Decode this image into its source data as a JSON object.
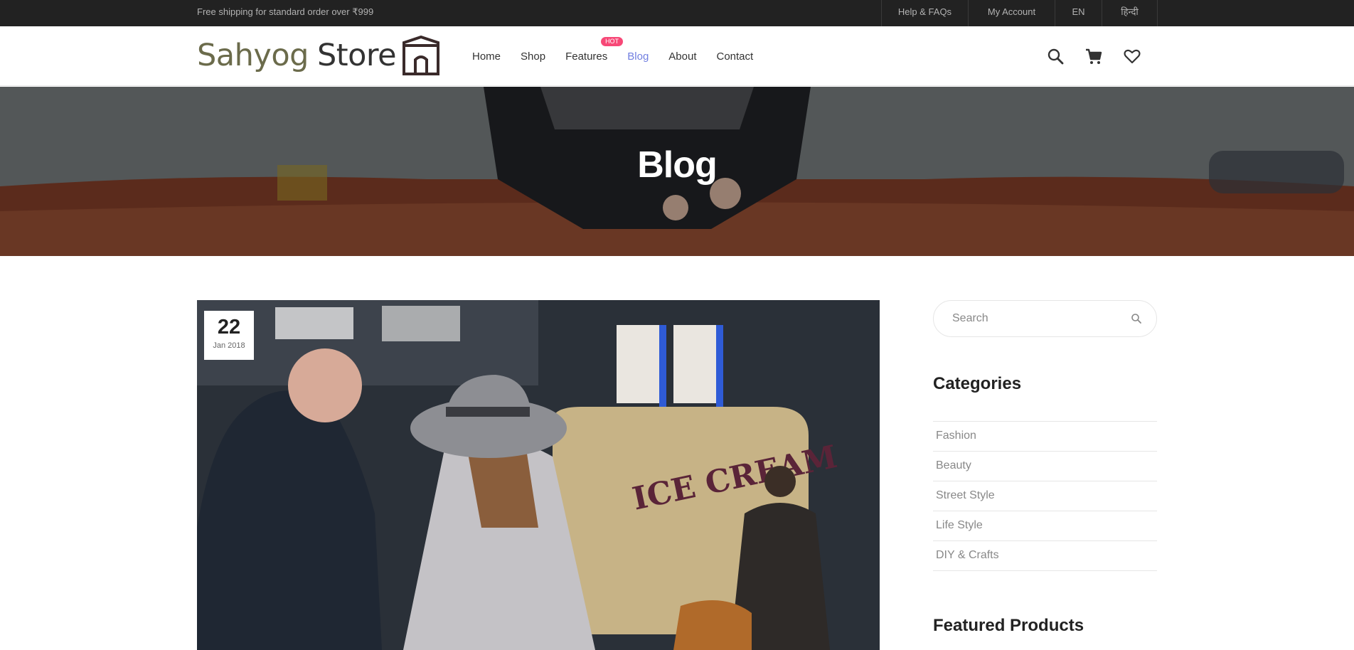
{
  "topbar": {
    "shipping_text": "Free shipping for standard order over ₹999",
    "links": [
      {
        "label": "Help & FAQs"
      },
      {
        "label": "My Account"
      },
      {
        "label": "EN"
      },
      {
        "label": "हिन्दी"
      }
    ]
  },
  "header": {
    "logo": {
      "part1": "Sahyog",
      "part2": "Store"
    },
    "nav": [
      {
        "label": "Home"
      },
      {
        "label": "Shop"
      },
      {
        "label": "Features",
        "badge": "HOT"
      },
      {
        "label": "Blog",
        "active": true
      },
      {
        "label": "About"
      },
      {
        "label": "Contact"
      }
    ],
    "icons": [
      "search-icon",
      "cart-icon",
      "heart-icon"
    ]
  },
  "banner": {
    "title": "Blog"
  },
  "post": {
    "day": "22",
    "month_year": "Jan 2018"
  },
  "sidebar": {
    "search_placeholder": "Search",
    "categories_title": "Categories",
    "categories": [
      "Fashion",
      "Beauty",
      "Street Style",
      "Life Style",
      "DIY & Crafts"
    ],
    "featured_title": "Featured Products"
  },
  "colors": {
    "topbar_bg": "#222222",
    "accent": "#717fe0",
    "hot_badge": "#f74877"
  }
}
